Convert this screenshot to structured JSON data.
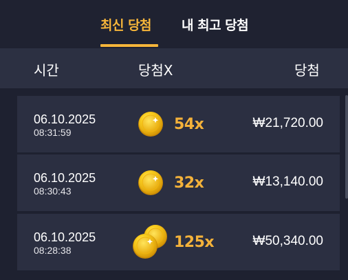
{
  "tabs": [
    {
      "label": "최신 당첨",
      "active": true
    },
    {
      "label": "내 최고 당첨",
      "active": false
    }
  ],
  "columns": {
    "time": "시간",
    "multiplier": "당첨X",
    "win": "당첨"
  },
  "rows": [
    {
      "date": "06.10.2025",
      "time": "08:31:59",
      "multiplier": "54x",
      "amount": "₩21,720.00",
      "icon": "single-coin-icon"
    },
    {
      "date": "06.10.2025",
      "time": "08:30:43",
      "multiplier": "32x",
      "amount": "₩13,140.00",
      "icon": "single-coin-icon"
    },
    {
      "date": "06.10.2025",
      "time": "08:28:38",
      "multiplier": "125x",
      "amount": "₩50,340.00",
      "icon": "double-coin-icon"
    }
  ],
  "colors": {
    "accent": "#f6b53a",
    "background": "#1f2231",
    "header": "#2c3042",
    "row": "#2b2f41",
    "coin": "#f5c320"
  }
}
